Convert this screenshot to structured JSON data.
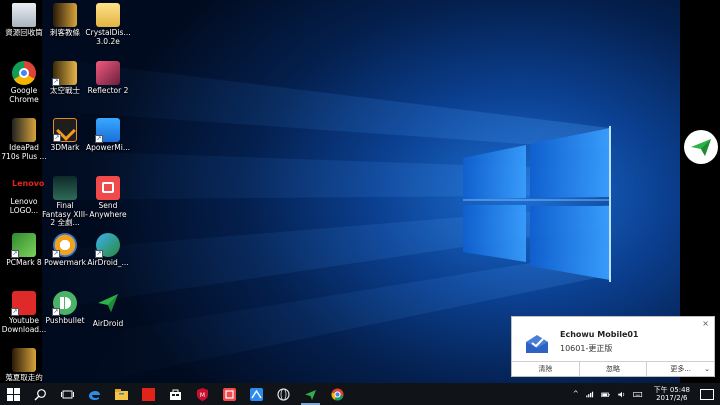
{
  "desktop_icons": [
    {
      "name": "recycle-bin",
      "label": "資源回收筒"
    },
    {
      "name": "assassin",
      "label": "刺客教條"
    },
    {
      "name": "crystaldisk",
      "label": "CrystalDis... 3.0.2e"
    },
    {
      "name": "google-chrome",
      "label": "Google Chrome"
    },
    {
      "name": "space-warrior",
      "label": "太空戰士"
    },
    {
      "name": "reflector",
      "label": "Reflector 2"
    },
    {
      "name": "ideapad",
      "label": "IdeaPad 710s Plus ..."
    },
    {
      "name": "3dmark",
      "label": "3DMark"
    },
    {
      "name": "apowermirror",
      "label": "ApowerMi..."
    },
    {
      "name": "lenovo-logo",
      "label": "Lenovo LOGO..."
    },
    {
      "name": "final-fantasy",
      "label": "Final Fantasy XIII-2 全劇..."
    },
    {
      "name": "send-anywhere",
      "label": "Send Anywhere"
    },
    {
      "name": "pcmark",
      "label": "PCMark 8"
    },
    {
      "name": "powermark",
      "label": "Powermark"
    },
    {
      "name": "airdroid-underscore",
      "label": "AirDroid_..."
    },
    {
      "name": "youtube-download",
      "label": "Youtube Download..."
    },
    {
      "name": "pushbullet",
      "label": "Pushbullet"
    },
    {
      "name": "airdroid",
      "label": "AirDroid"
    },
    {
      "name": "folder",
      "label": "蒐夏取走的"
    }
  ],
  "toast": {
    "title": "Echowu Mobile01",
    "body": "10601-更正版",
    "close": "×",
    "actions": [
      "清除",
      "忽略",
      "更多..."
    ],
    "more_chevron": "⌄"
  },
  "lenovo_text": "Lenovo",
  "taskbar": {
    "clock_time": "下午 05:48",
    "clock_date": "2017/2/6",
    "tray_arrow": "^"
  },
  "colors": {
    "taskbar": "#101318",
    "wallpaper_accent": "#1c6fd4"
  }
}
